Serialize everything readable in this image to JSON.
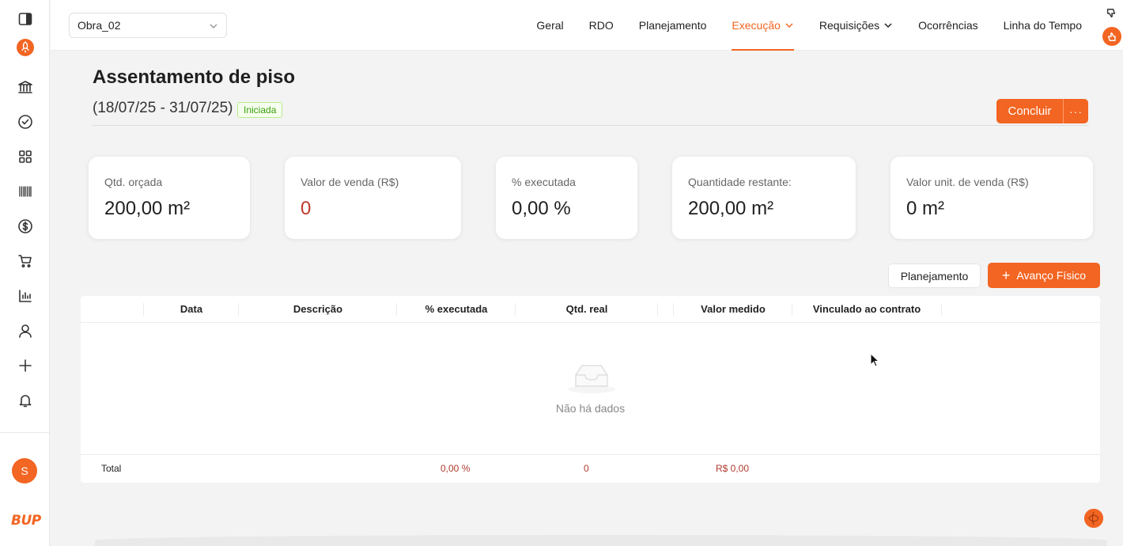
{
  "topbar": {
    "project": "Obra_02",
    "nav": [
      {
        "label": "Geral",
        "active": false,
        "dropdown": false
      },
      {
        "label": "RDO",
        "active": false,
        "dropdown": false
      },
      {
        "label": "Planejamento",
        "active": false,
        "dropdown": false
      },
      {
        "label": "Execução",
        "active": true,
        "dropdown": true
      },
      {
        "label": "Requisições",
        "active": false,
        "dropdown": true
      },
      {
        "label": "Ocorrências",
        "active": false,
        "dropdown": false
      },
      {
        "label": "Linha do Tempo",
        "active": false,
        "dropdown": false
      }
    ]
  },
  "sidebar": {
    "icons": [
      "panel-toggle-icon",
      "rocket-icon",
      "bank-icon",
      "check-circle-icon",
      "grid-icon",
      "barcode-icon",
      "dollar-icon",
      "cart-icon",
      "bar-chart-icon",
      "user-icon",
      "plus-icon",
      "bell-icon"
    ],
    "avatar_initial": "S",
    "logo": "BUP"
  },
  "header": {
    "title": "Assentamento de piso",
    "date_range": "(18/07/25 - 31/07/25)",
    "status": "Iniciada",
    "conclude_label": "Concluir",
    "more_label": "···"
  },
  "stats": [
    {
      "label": "Qtd. orçada",
      "value": "200,00 m²"
    },
    {
      "label": "Valor de venda (R$)",
      "value": "0"
    },
    {
      "label": "% executada",
      "value": "0,00 %"
    },
    {
      "label": "Quantidade restante:",
      "value": "200,00 m²"
    },
    {
      "label": "Valor unit. de venda (R$)",
      "value": "0 m²"
    }
  ],
  "actions": {
    "planning_label": "Planejamento",
    "advance_label": "Avanço Físico"
  },
  "table": {
    "columns": [
      "Data",
      "Descrição",
      "% executada",
      "Qtd. real",
      "Valor medido",
      "Vinculado ao contrato"
    ],
    "empty_text": "Não há dados",
    "footer": {
      "label": "Total",
      "percent": "0,00 %",
      "qty": "0",
      "value": "R$ 0,00"
    }
  },
  "colors": {
    "accent": "#f26522",
    "status_green": "#389e0d"
  }
}
